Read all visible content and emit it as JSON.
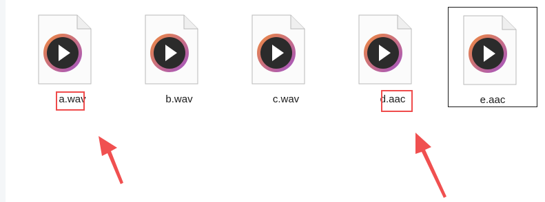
{
  "files": [
    {
      "name": "a.wav",
      "icon": "media-player-icon"
    },
    {
      "name": "b.wav",
      "icon": "media-player-icon"
    },
    {
      "name": "c.wav",
      "icon": "media-player-icon"
    },
    {
      "name": "d.aac",
      "icon": "media-player-icon"
    },
    {
      "name": "e.aac",
      "icon": "media-player-icon",
      "selected": true
    }
  ],
  "annotations": {
    "highlight_color": "#ef4b4b",
    "arrow_color": "#f05050"
  },
  "colors": {
    "icon_ring_orange": "#f08a3c",
    "icon_ring_purple": "#a052c8",
    "icon_disc": "#2b2b2b",
    "page_background": "#ffffff"
  }
}
